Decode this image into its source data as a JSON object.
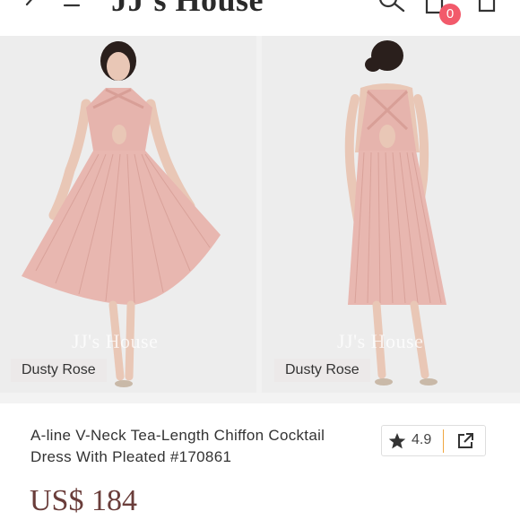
{
  "header": {
    "logo": "JJ's House",
    "cart_count": "0",
    "icons": [
      "back-icon",
      "menu-icon",
      "search-icon",
      "cart-icon",
      "bag-icon"
    ]
  },
  "gallery": {
    "images": [
      {
        "color_tag": "Dusty Rose",
        "watermark": "JJ's House",
        "view": "front"
      },
      {
        "color_tag": "Dusty Rose",
        "watermark": "JJ's House",
        "view": "back"
      }
    ]
  },
  "product": {
    "title": "A-line V-Neck Tea-Length Chiffon Cocktail Dress With Pleated #170861",
    "rating": "4.9",
    "price": "US$ 184"
  },
  "colors": {
    "accent": "#f25a6b",
    "price": "#6a3d3a",
    "dress": "#e8b7b0",
    "rating_separator": "#f0a640"
  }
}
